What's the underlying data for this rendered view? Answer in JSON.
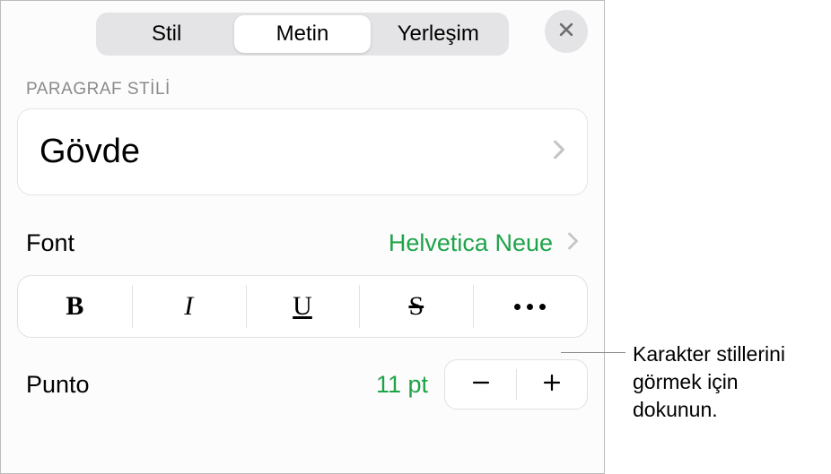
{
  "tabs": {
    "style": "Stil",
    "text": "Metin",
    "layout": "Yerleşim"
  },
  "section": {
    "paragraph_style_label": "PARAGRAF STİLİ"
  },
  "paragraph_style": {
    "name": "Gövde"
  },
  "font": {
    "label": "Font",
    "value": "Helvetica Neue"
  },
  "style_buttons": {
    "bold": "B",
    "italic": "I",
    "underline": "U",
    "strike": "S"
  },
  "size": {
    "label": "Punto",
    "value": "11 pt"
  },
  "callout": {
    "text": "Karakter stillerini görmek için dokunun."
  },
  "colors": {
    "accent": "#1fa34a"
  }
}
